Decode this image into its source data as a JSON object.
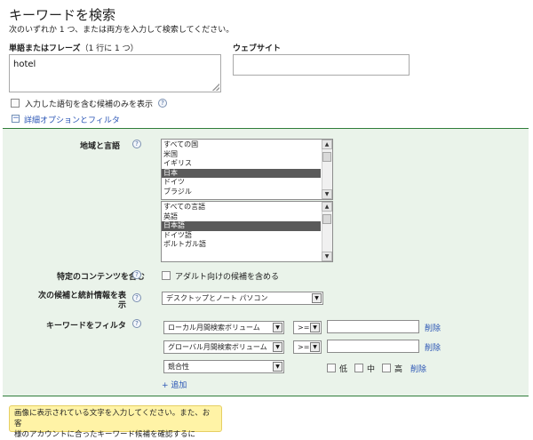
{
  "header": {
    "title": "キーワードを検索",
    "subtitle": "次のいずれか 1 つ、または両方を入力して検索してください。"
  },
  "phrase_field": {
    "label": "単語またはフレーズ",
    "note": "（1 行に 1 つ）",
    "value": "hotel"
  },
  "website_field": {
    "label": "ウェブサイト",
    "value": ""
  },
  "include_only": {
    "label": "入力した語句を含む候補のみを表示"
  },
  "advanced_toggle": {
    "icon": "−",
    "label": "詳細オプションとフィルタ"
  },
  "help_glyph": "?",
  "location_language": {
    "label": "地域と言語",
    "locations": [
      "すべての国",
      "米国",
      "イギリス",
      "日本",
      "ドイツ",
      "ブラジル"
    ],
    "selected_location": "日本",
    "languages": [
      "すべての言語",
      "英語",
      "日本語",
      "ドイツ語",
      "ポルトガル語"
    ],
    "selected_language": "日本語"
  },
  "adult_content": {
    "label": "特定のコンテンツを含む",
    "checkbox_label": "アダルト向けの候補を含める"
  },
  "device": {
    "label": "次の候補と統計情報を表示",
    "selected": "デスクトップとノート パソコン"
  },
  "filters": {
    "label": "キーワードをフィルタ",
    "rows": [
      {
        "metric": "ローカル月間検索ボリューム",
        "operator": ">=",
        "value": "",
        "remove": "削除"
      },
      {
        "metric": "グローバル月間検索ボリューム",
        "operator": ">=",
        "value": "",
        "remove": "削除"
      }
    ],
    "competition": {
      "metric": "競合性",
      "options": [
        "低",
        "中",
        "高"
      ],
      "remove": "削除"
    },
    "add": "+ 追加"
  },
  "tooltip": {
    "line1": "画像に表示されている文字を入力してください。また、お客",
    "line2": "様のアカウントに合ったキーワード候補を確認するに"
  },
  "colors": {
    "panel_bg": "#eaf3ea",
    "panel_border": "#2f7d3a",
    "link": "#2a55b5",
    "selection": "#5a5a5a",
    "tooltip_bg": "#fff3a6"
  }
}
